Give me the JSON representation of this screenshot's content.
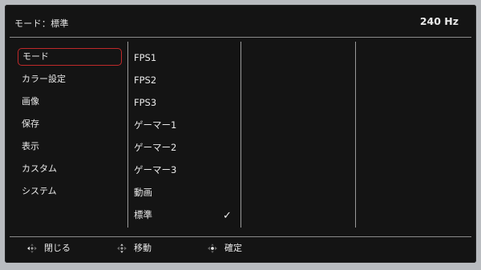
{
  "header": {
    "title": "モード：標準",
    "refresh": "240 Hz"
  },
  "menu": {
    "items": [
      {
        "label": "モード"
      },
      {
        "label": "カラー設定"
      },
      {
        "label": "画像"
      },
      {
        "label": "保存"
      },
      {
        "label": "表示"
      },
      {
        "label": "カスタム"
      },
      {
        "label": "システム"
      }
    ],
    "selected": "モード"
  },
  "options": {
    "items": [
      {
        "label": "FPS1"
      },
      {
        "label": "FPS2"
      },
      {
        "label": "FPS3"
      },
      {
        "label": "ゲーマー1"
      },
      {
        "label": "ゲーマー2"
      },
      {
        "label": "ゲーマー3"
      },
      {
        "label": "動画"
      },
      {
        "label": "標準"
      }
    ],
    "checked": "標準",
    "check_glyph": "✓"
  },
  "footer": {
    "close_label": "閉じる",
    "move_label": "移動",
    "confirm_label": "確定",
    "close_icon": "dpad-left-icon",
    "move_icon": "dpad-updown-icon",
    "confirm_icon": "dpad-center-icon"
  },
  "colors": {
    "background": "#141414",
    "selection_border": "#c0292a",
    "divider": "#8b8b8b",
    "text": "#e9e9e9"
  }
}
